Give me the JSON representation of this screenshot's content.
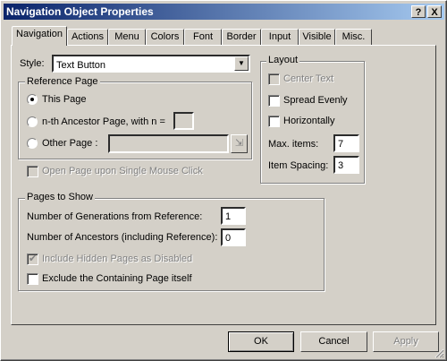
{
  "window": {
    "title": "Navigation Object Properties",
    "help_label": "?",
    "close_label": "X"
  },
  "tabs": [
    "Navigation",
    "Actions",
    "Menu",
    "Colors",
    "Font",
    "Border",
    "Input",
    "Visible",
    "Misc."
  ],
  "style": {
    "label": "Style:",
    "value": "Text Button"
  },
  "reference_page": {
    "title": "Reference Page",
    "this_page": "This Page",
    "nth_ancestor": "n-th Ancestor Page, with n =",
    "nth_value": "",
    "other_page": "Other Page :",
    "other_value": ""
  },
  "open_single_click": "Open Page upon Single Mouse Click",
  "layout": {
    "title": "Layout",
    "center_text": "Center Text",
    "spread_evenly": "Spread Evenly",
    "horizontally": "Horizontally",
    "max_items_label": "Max. items:",
    "max_items_value": "7",
    "item_spacing_label": "Item Spacing:",
    "item_spacing_value": "3"
  },
  "pages_to_show": {
    "title": "Pages to Show",
    "generations_label": "Number of Generations from Reference:",
    "generations_value": "1",
    "ancestors_label": "Number of Ancestors (including Reference):",
    "ancestors_value": "0",
    "include_hidden": "Include Hidden Pages as Disabled",
    "exclude_containing": "Exclude the Containing Page itself"
  },
  "buttons": {
    "ok": "OK",
    "cancel": "Cancel",
    "apply": "Apply"
  }
}
